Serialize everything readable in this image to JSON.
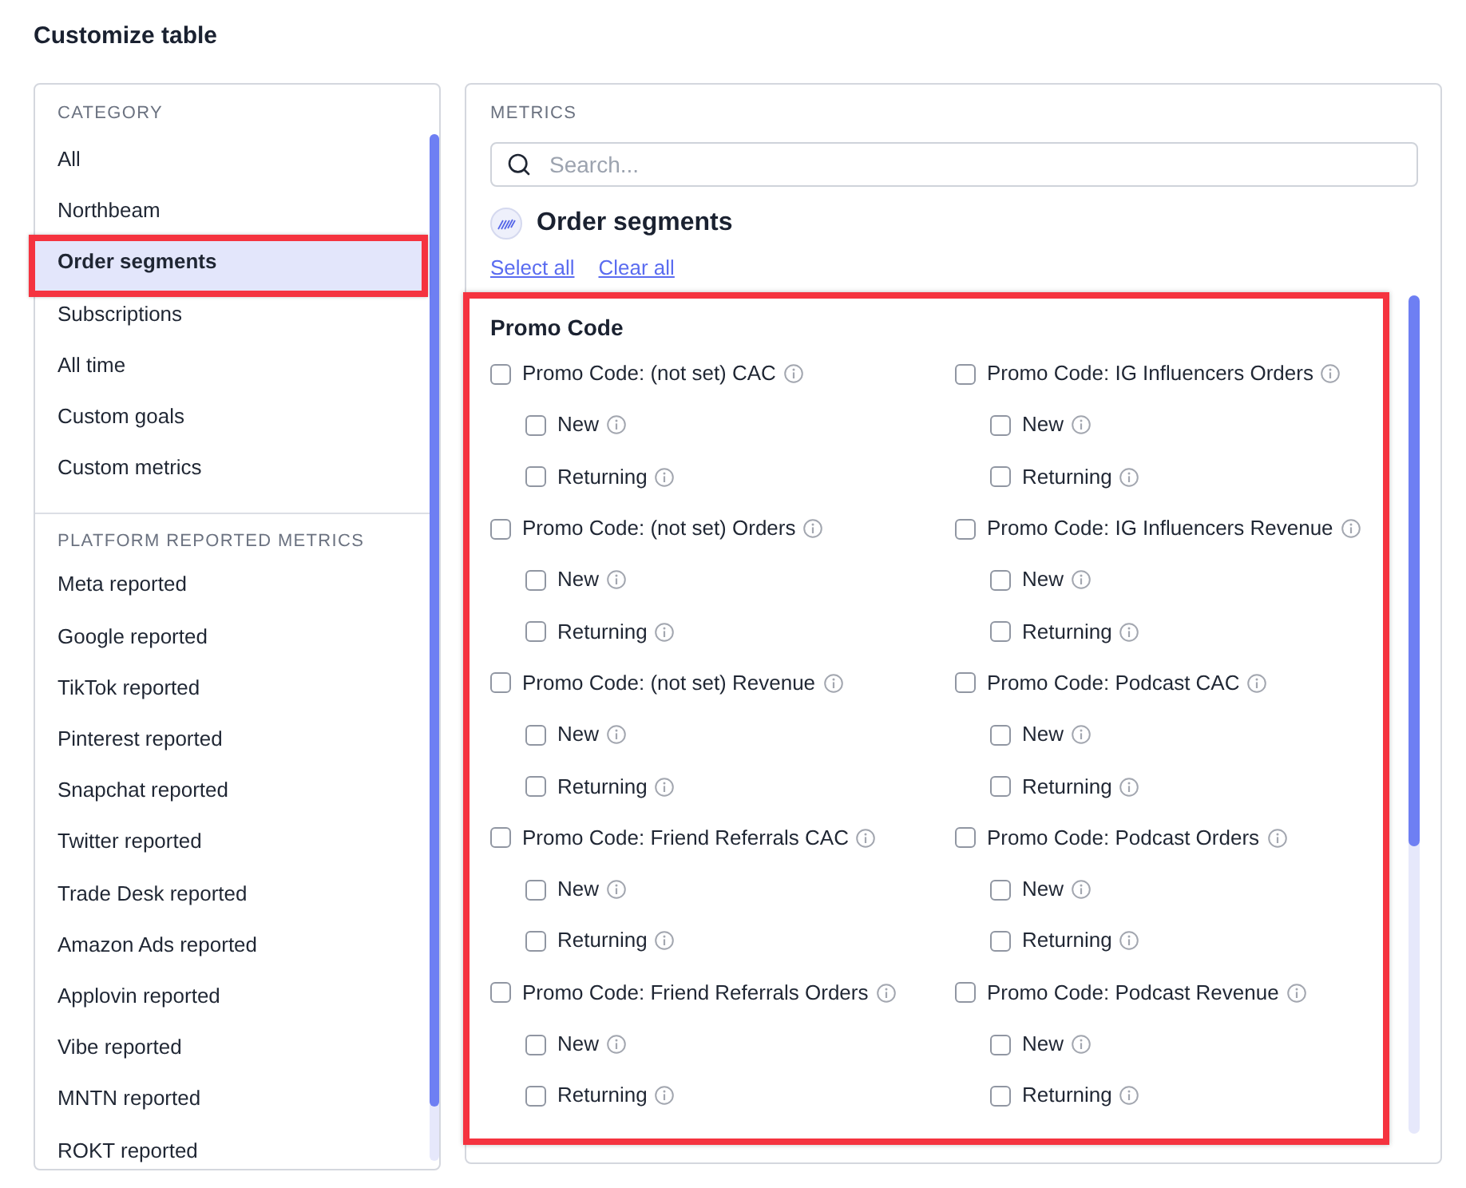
{
  "title": "Customize table",
  "categories": {
    "sections": [
      {
        "heading": "CATEGORY",
        "items": [
          {
            "label": "All",
            "selected": false,
            "highlighted": false
          },
          {
            "label": "Northbeam",
            "selected": false,
            "highlighted": false
          },
          {
            "label": "Order segments",
            "selected": true,
            "highlighted": true
          },
          {
            "label": "Subscriptions",
            "selected": false,
            "highlighted": false
          },
          {
            "label": "All time",
            "selected": false,
            "highlighted": false
          },
          {
            "label": "Custom goals",
            "selected": false,
            "highlighted": false
          },
          {
            "label": "Custom metrics",
            "selected": false,
            "highlighted": false
          }
        ]
      },
      {
        "heading": "PLATFORM REPORTED METRICS",
        "items": [
          {
            "label": "Meta reported",
            "selected": false,
            "highlighted": false
          },
          {
            "label": "Google reported",
            "selected": false,
            "highlighted": false
          },
          {
            "label": "TikTok reported",
            "selected": false,
            "highlighted": false
          },
          {
            "label": "Pinterest reported",
            "selected": false,
            "highlighted": false
          },
          {
            "label": "Snapchat reported",
            "selected": false,
            "highlighted": false
          },
          {
            "label": "Twitter reported",
            "selected": false,
            "highlighted": false
          },
          {
            "label": "Trade Desk reported",
            "selected": false,
            "highlighted": false
          },
          {
            "label": "Amazon Ads reported",
            "selected": false,
            "highlighted": false
          },
          {
            "label": "Applovin reported",
            "selected": false,
            "highlighted": false
          },
          {
            "label": "Vibe reported",
            "selected": false,
            "highlighted": false
          },
          {
            "label": "MNTN reported",
            "selected": false,
            "highlighted": false
          },
          {
            "label": "ROKT reported",
            "selected": false,
            "highlighted": false
          }
        ]
      }
    ]
  },
  "metrics": {
    "heading": "METRICS",
    "search": {
      "placeholder": "Search..."
    },
    "group_title": "Order segments",
    "actions": [
      "Select all",
      "Clear all"
    ],
    "sections": [
      {
        "title": "Promo Code",
        "highlighted": true,
        "items": [
          {
            "label": "Promo Code: (not set) CAC",
            "checked": false,
            "children": [
              {
                "label": "New",
                "checked": false
              },
              {
                "label": "Returning",
                "checked": false
              }
            ]
          },
          {
            "label": "Promo Code: (not set) Orders",
            "checked": false,
            "children": [
              {
                "label": "New",
                "checked": false
              },
              {
                "label": "Returning",
                "checked": false
              }
            ]
          },
          {
            "label": "Promo Code: (not set) Revenue",
            "checked": false,
            "children": [
              {
                "label": "New",
                "checked": false
              },
              {
                "label": "Returning",
                "checked": false
              }
            ]
          },
          {
            "label": "Promo Code: Friend Referrals CAC",
            "checked": false,
            "children": [
              {
                "label": "New",
                "checked": false
              },
              {
                "label": "Returning",
                "checked": false
              }
            ]
          },
          {
            "label": "Promo Code: Friend Referrals Orders",
            "checked": false,
            "children": [
              {
                "label": "New",
                "checked": false
              },
              {
                "label": "Returning",
                "checked": false
              }
            ]
          },
          {
            "label": "Promo Code: IG Influencers Orders",
            "checked": false,
            "children": [
              {
                "label": "New",
                "checked": false
              },
              {
                "label": "Returning",
                "checked": false
              }
            ]
          },
          {
            "label": "Promo Code: IG Influencers Revenue",
            "checked": false,
            "children": [
              {
                "label": "New",
                "checked": false
              },
              {
                "label": "Returning",
                "checked": false
              }
            ]
          },
          {
            "label": "Promo Code: Podcast CAC",
            "checked": false,
            "children": [
              {
                "label": "New",
                "checked": false
              },
              {
                "label": "Returning",
                "checked": false
              }
            ]
          },
          {
            "label": "Promo Code: Podcast Orders",
            "checked": false,
            "children": [
              {
                "label": "New",
                "checked": false
              },
              {
                "label": "Returning",
                "checked": false
              }
            ]
          },
          {
            "label": "Promo Code: Podcast Revenue",
            "checked": false,
            "children": [
              {
                "label": "New",
                "checked": false
              },
              {
                "label": "Returning",
                "checked": false
              }
            ]
          }
        ]
      }
    ]
  }
}
